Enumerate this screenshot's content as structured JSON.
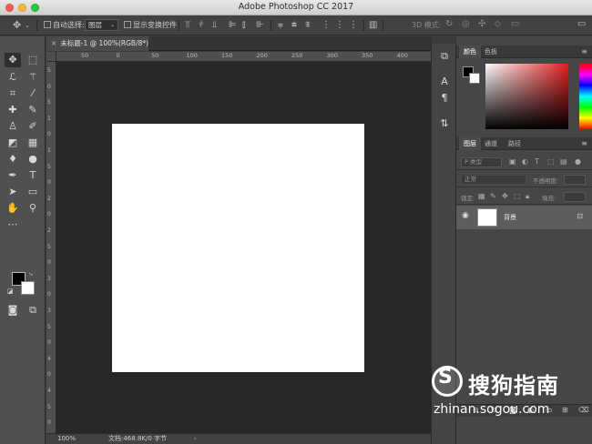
{
  "window": {
    "title": "Adobe Photoshop CC 2017"
  },
  "options_bar": {
    "move_icon": "move-tool-icon",
    "auto_select_label": "自动选择:",
    "auto_select_value": "图层",
    "show_transform_label": "显示变换控件",
    "mode_3d_label": "3D 模式:"
  },
  "document": {
    "tab_label": "未标题-1 @ 100%(RGB/8*)",
    "close_glyph": "×"
  },
  "ruler": {
    "top_ticks": [
      "50",
      "0",
      "50",
      "100",
      "150",
      "200",
      "250",
      "300",
      "350",
      "400",
      "450"
    ],
    "left_ticks": [
      "5",
      "0",
      "5",
      "1",
      "0",
      "1",
      "5",
      "0",
      "2",
      "0",
      "2",
      "5",
      "0",
      "3",
      "0",
      "3",
      "5",
      "0",
      "4",
      "0",
      "4",
      "5",
      "0"
    ]
  },
  "status_bar": {
    "zoom": "100%",
    "doc_info": "文档:468.8K/0 字节",
    "arrow": "›"
  },
  "color_panel": {
    "tabs": [
      "颜色",
      "色板"
    ],
    "foreground": "#000000",
    "background": "#ffffff"
  },
  "layers_panel": {
    "tabs": [
      "图层",
      "通道",
      "路径"
    ],
    "filter_label": "P 类型",
    "blend_mode": "正常",
    "opacity_label": "不透明度:",
    "lock_label": "锁定:",
    "fill_label": "填充:",
    "layer_name": "背景"
  },
  "watermark": {
    "brand_cn": "搜狗指南",
    "url": "zhinan.sogou.com",
    "glyph": "S"
  },
  "colors": {
    "canvas_bg": "#282828",
    "panel_bg": "#464646",
    "toolbar_bg": "#505050"
  }
}
